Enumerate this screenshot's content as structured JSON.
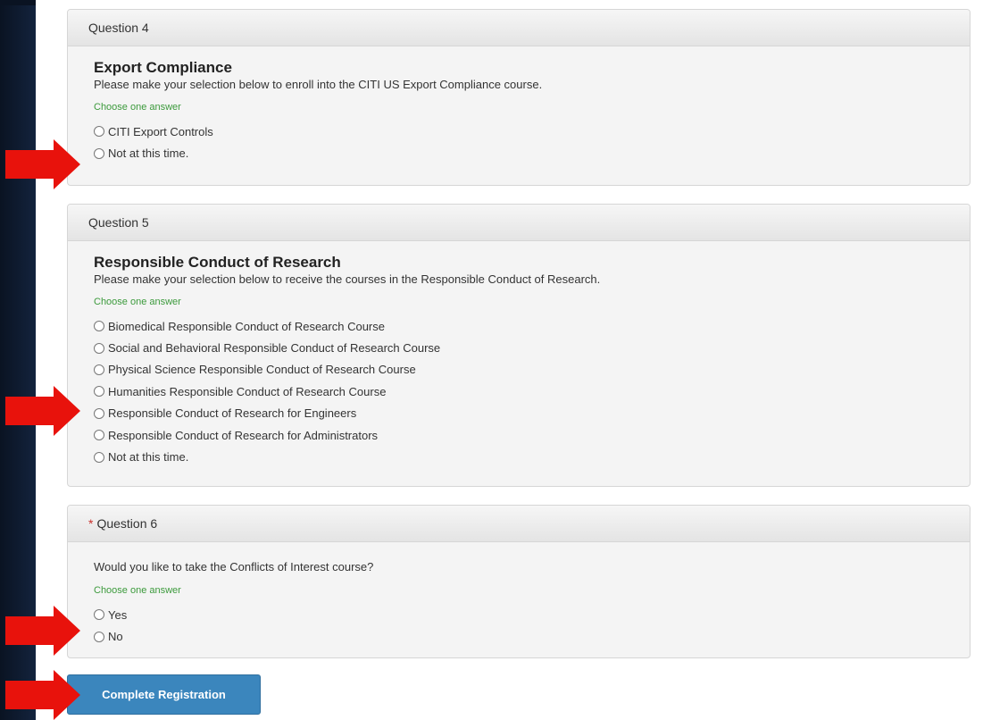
{
  "questions": [
    {
      "header": "Question 4",
      "title": "Export Compliance",
      "description": "Please make your selection below to enroll into the CITI US Export Compliance course.",
      "hint": "Choose one answer",
      "options": [
        "CITI Export Controls",
        "Not at this time."
      ]
    },
    {
      "header": "Question 5",
      "title": "Responsible Conduct of Research",
      "description": "Please make your selection below to receive the courses in the Responsible Conduct of Research.",
      "hint": "Choose one answer",
      "options": [
        "Biomedical Responsible Conduct of Research Course",
        "Social and Behavioral Responsible Conduct of Research Course",
        "Physical Science Responsible Conduct of Research Course",
        "Humanities Responsible Conduct of Research Course",
        "Responsible Conduct of Research for Engineers",
        "Responsible Conduct of Research for Administrators",
        "Not at this time."
      ]
    },
    {
      "required_mark": "*",
      "header": "Question 6",
      "description": "Would you like to take the Conflicts of Interest course?",
      "hint": "Choose one answer",
      "options": [
        "Yes",
        "No"
      ]
    }
  ],
  "submit": {
    "label": "Complete Registration"
  },
  "colors": {
    "annotation_arrow": "#e8120c",
    "button": "#3b86bd",
    "hint_text": "#3c9a3c",
    "required_star": "#c9302c"
  }
}
